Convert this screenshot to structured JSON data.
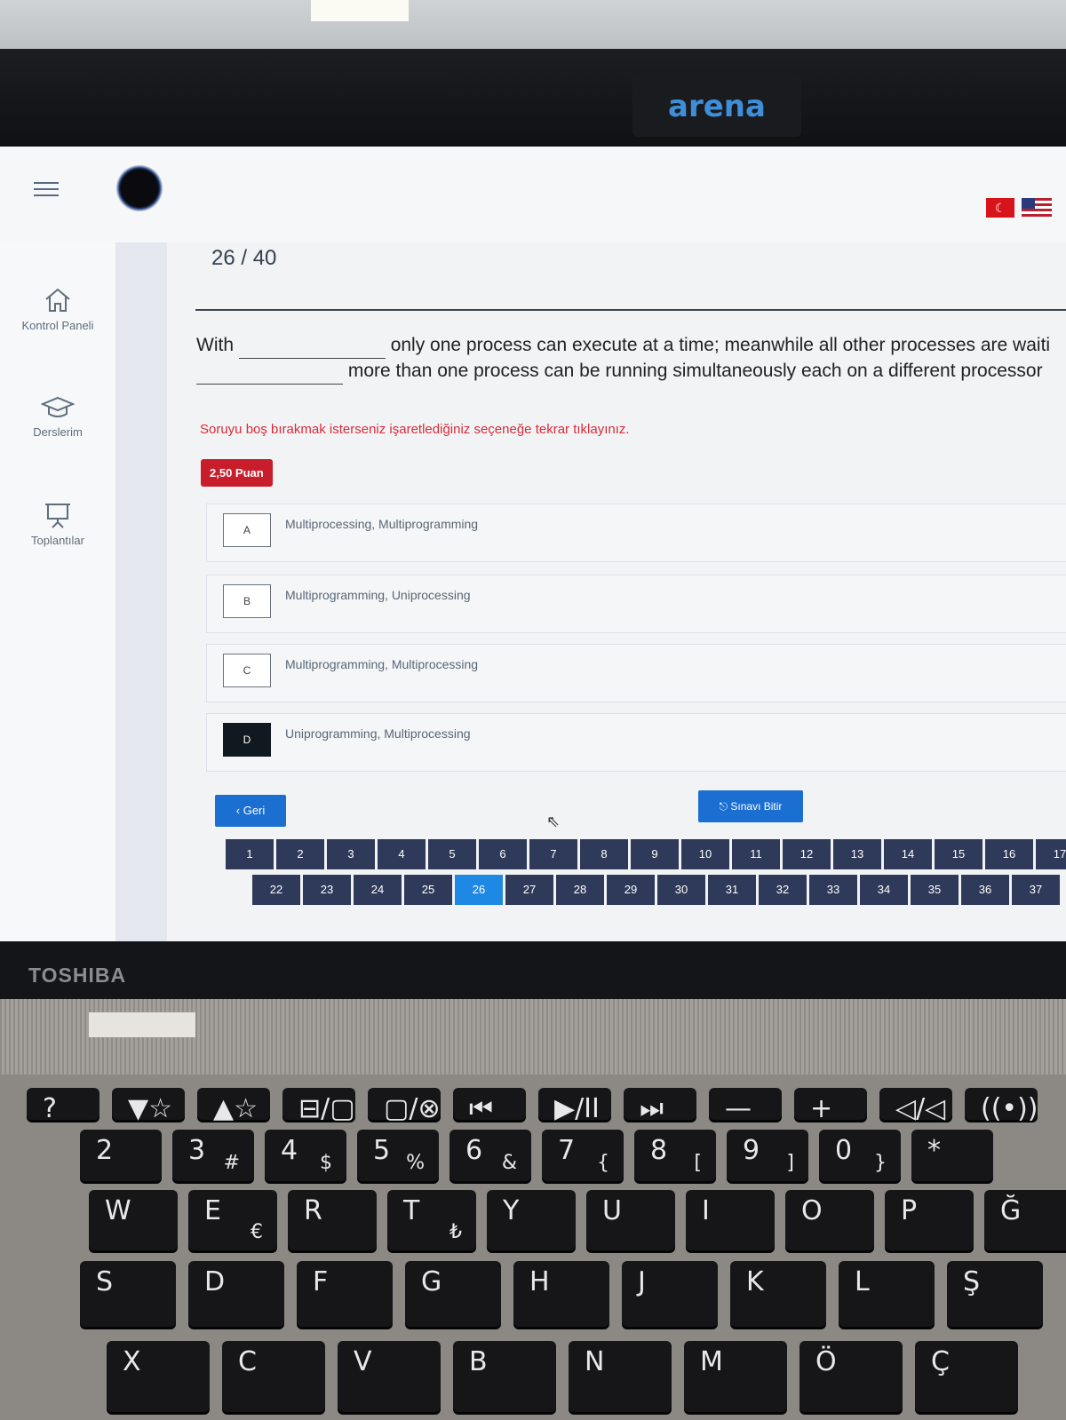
{
  "camera_brand": "arena",
  "laptop_brand": "TOSHIBA",
  "nav": {
    "items": [
      {
        "label": "Kontrol Paneli"
      },
      {
        "label": "Derslerim"
      },
      {
        "label": "Toplantılar"
      }
    ]
  },
  "exam": {
    "counter": "26 / 40",
    "question_line1_start": "With",
    "question_line1_end": "only one process can execute at a time; meanwhile all other processes are waiti",
    "question_line2_end": "more than one process can be running simultaneously each on a different processor",
    "hint": "Soruyu boş bırakmak isterseniz işaretlediğiniz seçeneğe tekrar tıklayınız.",
    "points": "2,50 Puan",
    "options": [
      {
        "letter": "A",
        "text": "Multiprocessing, Multiprogramming",
        "selected": false
      },
      {
        "letter": "B",
        "text": "Multiprogramming, Uniprocessing",
        "selected": false
      },
      {
        "letter": "C",
        "text": "Multiprogramming, Multiprocessing",
        "selected": false
      },
      {
        "letter": "D",
        "text": "Uniprogramming, Multiprocessing",
        "selected": true
      }
    ],
    "back_label": "Geri",
    "finish_label": "Sınavı Bitir",
    "pager_row1": [
      "1",
      "2",
      "3",
      "4",
      "5",
      "6",
      "7",
      "8",
      "9",
      "10",
      "11",
      "12",
      "13",
      "14",
      "15",
      "16",
      "17"
    ],
    "pager_row2": [
      "22",
      "23",
      "24",
      "25",
      "26",
      "27",
      "28",
      "29",
      "30",
      "31",
      "32",
      "33",
      "34",
      "35",
      "36",
      "37"
    ],
    "current_question": "26"
  },
  "keyboard": {
    "row_fn": [
      "?",
      "▼☆",
      "▲☆",
      "⊟/▢",
      "▢/⊗",
      "⏮",
      "▶/II",
      "⏭",
      "—",
      "+",
      "◁/◁",
      "((•))"
    ],
    "row_num": [
      "2",
      "3",
      "4",
      "5",
      "6",
      "7",
      "8",
      "9",
      "0",
      "*"
    ],
    "row_num_sub": [
      "",
      "#",
      "$",
      "%",
      "&",
      "{",
      "[",
      "]",
      "}",
      ""
    ],
    "row_q": [
      "W",
      "E",
      "R",
      "T",
      "Y",
      "U",
      "I",
      "O",
      "P",
      "Ğ"
    ],
    "row_q_sub": [
      "",
      "€",
      "",
      "₺",
      "",
      "",
      "",
      "",
      "",
      ""
    ],
    "row_a": [
      "S",
      "D",
      "F",
      "G",
      "H",
      "J",
      "K",
      "L",
      "Ş"
    ],
    "row_z": [
      "X",
      "C",
      "V",
      "B",
      "N",
      "M",
      "Ö",
      "Ç"
    ]
  },
  "colors": {
    "accent": "#1b6fd1",
    "points_badge": "#c81e2c",
    "hint_text": "#d62c3a",
    "pager": "#2f3a5a",
    "pager_current": "#1e88e5"
  }
}
